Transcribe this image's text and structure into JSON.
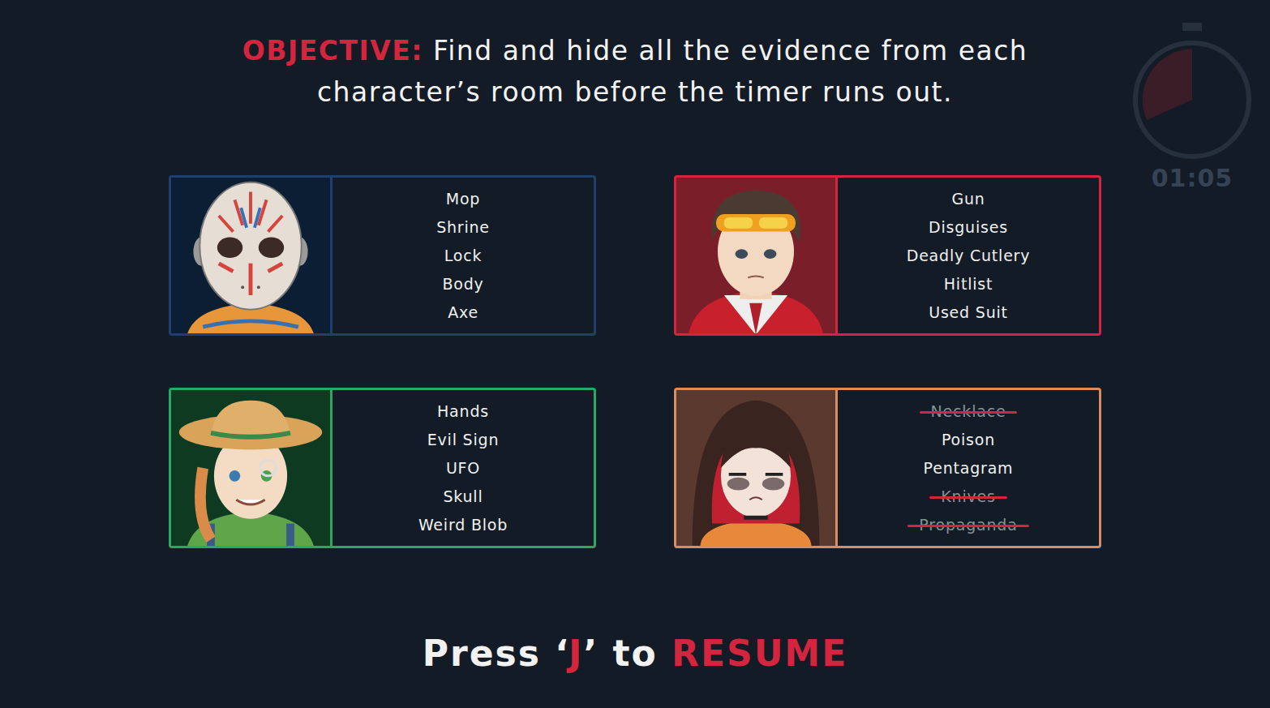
{
  "objective": {
    "label": "OBJECTIVE:",
    "text_lines": [
      "Find and hide all the evidence from each",
      "character’s room before the timer runs out."
    ]
  },
  "timer": "01:05",
  "characters": [
    {
      "portrait": "mask",
      "color": "#1f3f6e",
      "items": [
        {
          "text": "Mop",
          "found": false
        },
        {
          "text": "Shrine",
          "found": false
        },
        {
          "text": "Lock",
          "found": false
        },
        {
          "text": "Body",
          "found": false
        },
        {
          "text": "Axe",
          "found": false
        }
      ]
    },
    {
      "portrait": "goggles",
      "color": "#d3253d",
      "items": [
        {
          "text": "Gun",
          "found": false
        },
        {
          "text": "Disguises",
          "found": false
        },
        {
          "text": "Deadly Cutlery",
          "found": false
        },
        {
          "text": "Hitlist",
          "found": false
        },
        {
          "text": "Used Suit",
          "found": false
        }
      ]
    },
    {
      "portrait": "farmer",
      "color": "#2aa862",
      "items": [
        {
          "text": "Hands",
          "found": false
        },
        {
          "text": "Evil Sign",
          "found": false
        },
        {
          "text": "UFO",
          "found": false
        },
        {
          "text": "Skull",
          "found": false
        },
        {
          "text": "Weird Blob",
          "found": false
        }
      ]
    },
    {
      "portrait": "hood",
      "color": "#d98c5f",
      "items": [
        {
          "text": "Necklace",
          "found": true
        },
        {
          "text": "Poison",
          "found": false
        },
        {
          "text": "Pentagram",
          "found": false
        },
        {
          "text": "Knives",
          "found": true
        },
        {
          "text": "Propaganda",
          "found": true
        }
      ]
    }
  ],
  "prompt": {
    "before": "Press ‘",
    "key": "J",
    "middle": "’ to ",
    "action": "RESUME"
  }
}
